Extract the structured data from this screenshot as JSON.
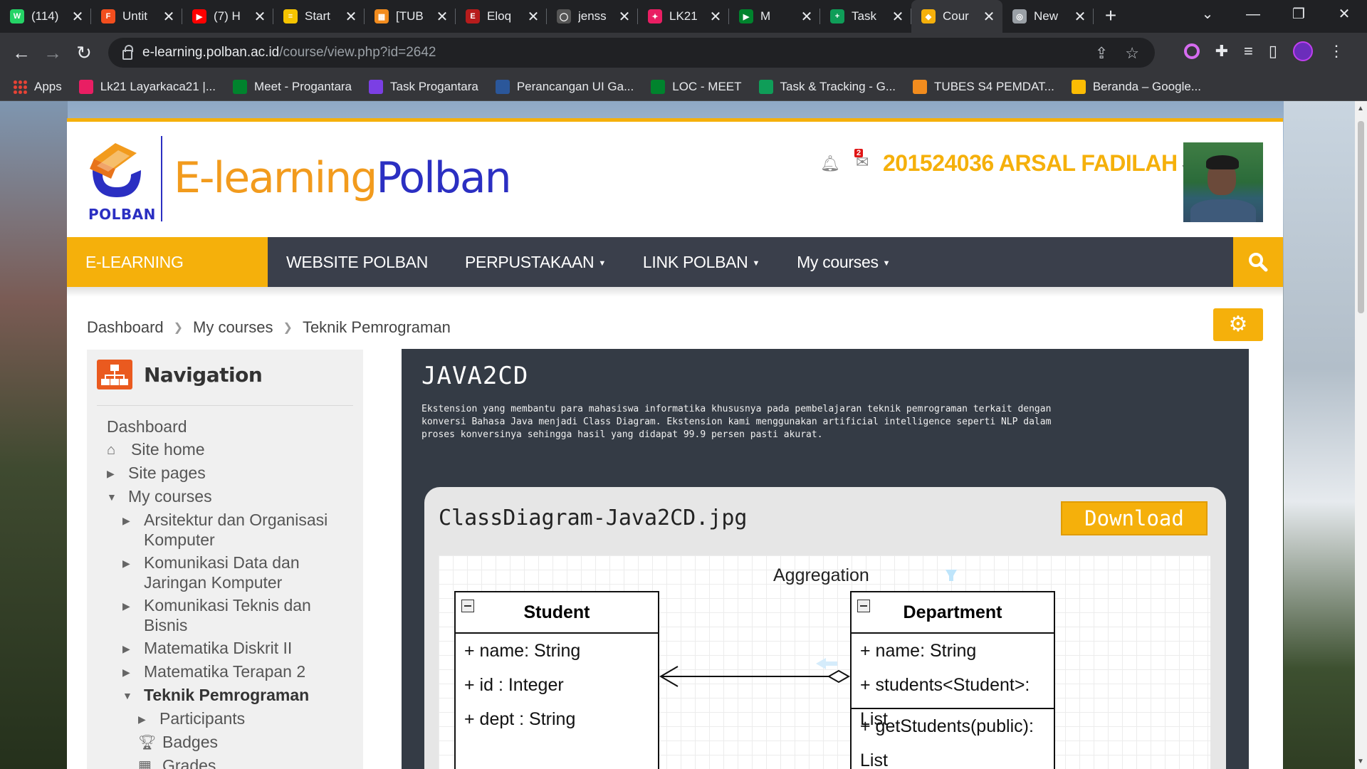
{
  "browser": {
    "tabs": [
      {
        "title": "(114)",
        "color": "#25d366",
        "glyph": "W"
      },
      {
        "title": "Untit",
        "color": "#f24e1e",
        "glyph": "F"
      },
      {
        "title": "(7) H",
        "color": "#ff0000",
        "glyph": "▶"
      },
      {
        "title": "Start",
        "color": "#f5c400",
        "glyph": "≡"
      },
      {
        "title": "[TUB",
        "color": "#f28c1e",
        "glyph": "▦"
      },
      {
        "title": "Eloq",
        "color": "#b71c1c",
        "glyph": "E"
      },
      {
        "title": "jenss",
        "color": "#555555",
        "glyph": "◯"
      },
      {
        "title": "LK21",
        "color": "#e91e63",
        "glyph": "✦"
      },
      {
        "title": "M",
        "color": "#00832d",
        "glyph": "▶"
      },
      {
        "title": "Task",
        "color": "#0f9d58",
        "glyph": "+"
      },
      {
        "title": "Cour",
        "color": "#f5b00b",
        "glyph": "◆",
        "active": true
      },
      {
        "title": "New",
        "color": "#9aa0a6",
        "glyph": "◎"
      }
    ],
    "new_tab_label": "+",
    "url_host": "e-learning.polban.ac.id",
    "url_path": "/course/view.php?id=2642",
    "bookmarks": [
      {
        "label": "Apps",
        "color": "#ea4335"
      },
      {
        "label": "Lk21 Layarkaca21 |...",
        "color": "#e91e63"
      },
      {
        "label": "Meet - Progantara",
        "color": "#00832d"
      },
      {
        "label": "Task Progantara",
        "color": "#7b3fe4"
      },
      {
        "label": "Perancangan UI Ga...",
        "color": "#2b579a"
      },
      {
        "label": "LOC - MEET",
        "color": "#00832d"
      },
      {
        "label": "Task & Tracking - G...",
        "color": "#0f9d58"
      },
      {
        "label": "TUBES S4 PEMDAT...",
        "color": "#f28c1e"
      },
      {
        "label": "Beranda – Google...",
        "color": "#fbbc04"
      }
    ]
  },
  "site": {
    "logo_polban": "POLBAN",
    "logo_e": "E-learning",
    "logo_p": "Polban",
    "notif_count": "2",
    "username": "201524036 ARSAL FADILAH",
    "accent": "#f5b00b",
    "nav": [
      {
        "label": "E-LEARNING POLBAN",
        "active": true
      },
      {
        "label": "WEBSITE POLBAN"
      },
      {
        "label": "PERPUSTAKAAN",
        "dropdown": true
      },
      {
        "label": "LINK POLBAN",
        "dropdown": true
      },
      {
        "label": "My courses",
        "dropdown": true
      }
    ],
    "breadcrumb": [
      "Dashboard",
      "My courses",
      "Teknik Pemrograman"
    ]
  },
  "navigation": {
    "title": "Navigation",
    "items": [
      {
        "label": "Dashboard",
        "level": 0,
        "arrow": ""
      },
      {
        "label": "Site home",
        "level": 0,
        "arrow": "home"
      },
      {
        "label": "Site pages",
        "level": 0,
        "arrow": "right"
      },
      {
        "label": "My courses",
        "level": 0,
        "arrow": "down"
      },
      {
        "label": "Arsitektur dan Organisasi Komputer",
        "level": 1,
        "arrow": "right"
      },
      {
        "label": "Komunikasi Data dan Jaringan Komputer",
        "level": 1,
        "arrow": "right"
      },
      {
        "label": "Komunikasi Teknis dan Bisnis",
        "level": 1,
        "arrow": "right"
      },
      {
        "label": "Matematika Diskrit II",
        "level": 1,
        "arrow": "right"
      },
      {
        "label": "Matematika Terapan 2",
        "level": 1,
        "arrow": "right"
      },
      {
        "label": "Teknik Pemrograman",
        "level": 1,
        "arrow": "down",
        "current": true
      },
      {
        "label": "Participants",
        "level": 2,
        "arrow": "right"
      },
      {
        "label": "Badges",
        "level": 2,
        "arrow": "trophy"
      },
      {
        "label": "Grades",
        "level": 2,
        "arrow": "grid"
      }
    ]
  },
  "section": {
    "title": "JAVA2CD",
    "description": "Ekstension yang membantu para mahasiswa informatika khususnya pada pembelajaran teknik pemrograman terkait dengan konversi Bahasa Java menjadi Class Diagram. Ekstension kami menggunakan artificial intelligence seperti NLP dalam proses konversinya sehingga hasil yang didapat 99.9 persen pasti akurat.",
    "file_name": "ClassDiagram-Java2CD.jpg",
    "download_label": "Download",
    "diagram": {
      "relation_label": "Aggregation",
      "student": {
        "name": "Student",
        "attrs": [
          "+ name: String",
          "+ id : Integer",
          "+ dept : String"
        ]
      },
      "department": {
        "name": "Department",
        "attrs": [
          "+ name: String",
          "+ students<Student>: List"
        ],
        "methods": [
          "+ getStudents(public): List"
        ]
      }
    }
  }
}
